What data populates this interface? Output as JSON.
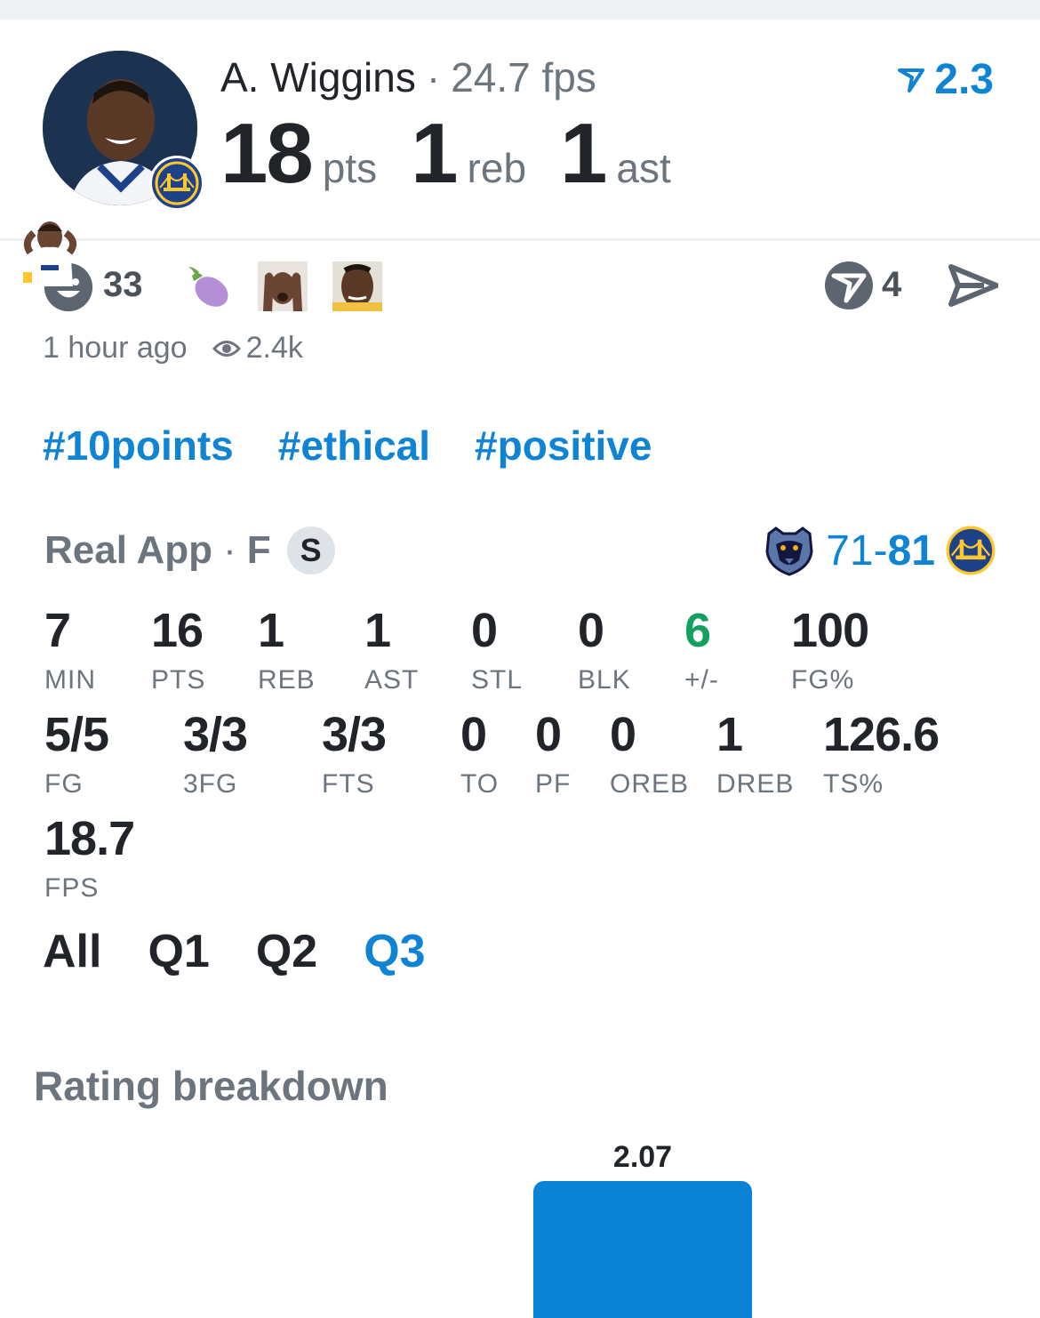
{
  "player": {
    "name": "A. Wiggins",
    "separator": "·",
    "fps": "24.7 fps",
    "rating": "2.3",
    "pts": "18",
    "pts_label": "pts",
    "reb": "1",
    "reb_label": "reb",
    "ast": "1",
    "ast_label": "ast"
  },
  "social": {
    "reactions": "33",
    "comments": "4",
    "time": "1 hour ago",
    "views": "2.4k"
  },
  "tags": [
    "#10points",
    "#ethical",
    "#positive"
  ],
  "game": {
    "source": "Real App",
    "separator": "·",
    "position": "F",
    "badge": "S",
    "score_away": "71",
    "score_dash": "-",
    "score_home": "81"
  },
  "stats_row1": [
    {
      "value": "7",
      "label": "MIN"
    },
    {
      "value": "16",
      "label": "PTS"
    },
    {
      "value": "1",
      "label": "REB"
    },
    {
      "value": "1",
      "label": "AST"
    },
    {
      "value": "0",
      "label": "STL"
    },
    {
      "value": "0",
      "label": "BLK"
    },
    {
      "value": "6",
      "label": "+/-"
    },
    {
      "value": "100",
      "label": "FG%"
    }
  ],
  "stats_row2": [
    {
      "value": "5/5",
      "label": "FG"
    },
    {
      "value": "3/3",
      "label": "3FG"
    },
    {
      "value": "3/3",
      "label": "FTS"
    },
    {
      "value": "0",
      "label": "TO"
    },
    {
      "value": "0",
      "label": "PF"
    },
    {
      "value": "0",
      "label": "OREB"
    },
    {
      "value": "1",
      "label": "DREB"
    },
    {
      "value": "126.6",
      "label": "TS%"
    }
  ],
  "stats_row3": [
    {
      "value": "18.7",
      "label": "FPS"
    }
  ],
  "quarters": [
    "All",
    "Q1",
    "Q2",
    "Q3"
  ],
  "active_quarter": "Q3",
  "rating_breakdown": {
    "title": "Rating breakdown"
  },
  "chart_data": {
    "type": "bar",
    "categories": [
      ""
    ],
    "values": [
      2.07
    ],
    "value_labels": [
      "2.07"
    ],
    "title": "Rating breakdown"
  },
  "colors": {
    "accent": "#0f83d4",
    "positive": "#12a05c",
    "muted": "#6c757d",
    "text": "#212529"
  }
}
